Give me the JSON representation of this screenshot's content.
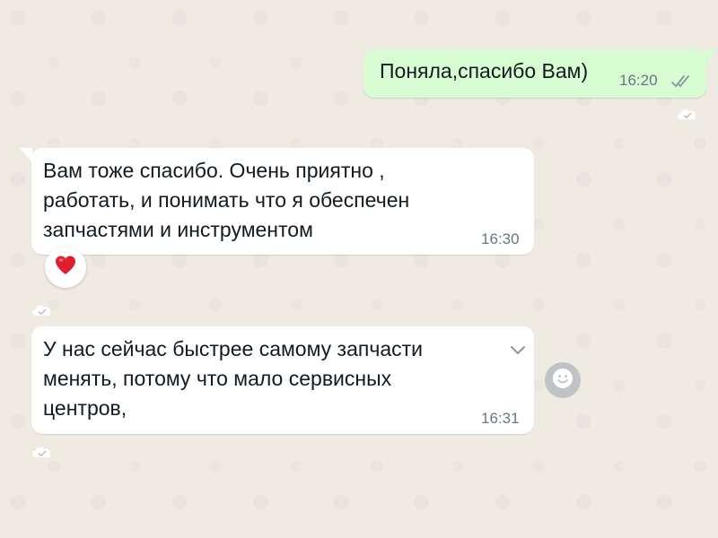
{
  "messages": [
    {
      "direction": "outgoing",
      "text": "Поняла,спасибо Вам)",
      "time": "16:20",
      "status_icon": "double-check-icon"
    },
    {
      "direction": "incoming",
      "text": "Вам тоже спасибо. Очень приятно ,\nработать, и понимать что я обеспечен\nзапчастями и инструментом",
      "time": "16:30",
      "reaction": "❤️"
    },
    {
      "direction": "incoming",
      "text": "У нас сейчас быстрее самому запчасти\nменять, потому что мало сервисных\nцентров,",
      "time": "16:31",
      "menu_icon": "chevron-down-icon",
      "side_action_icon": "smiley-icon"
    }
  ],
  "colors": {
    "background": "#efeae2",
    "outgoing_bubble": "#d9fdd3",
    "incoming_bubble": "#ffffff",
    "timestamp": "#667781",
    "read_ticks": "#8a98a1"
  }
}
